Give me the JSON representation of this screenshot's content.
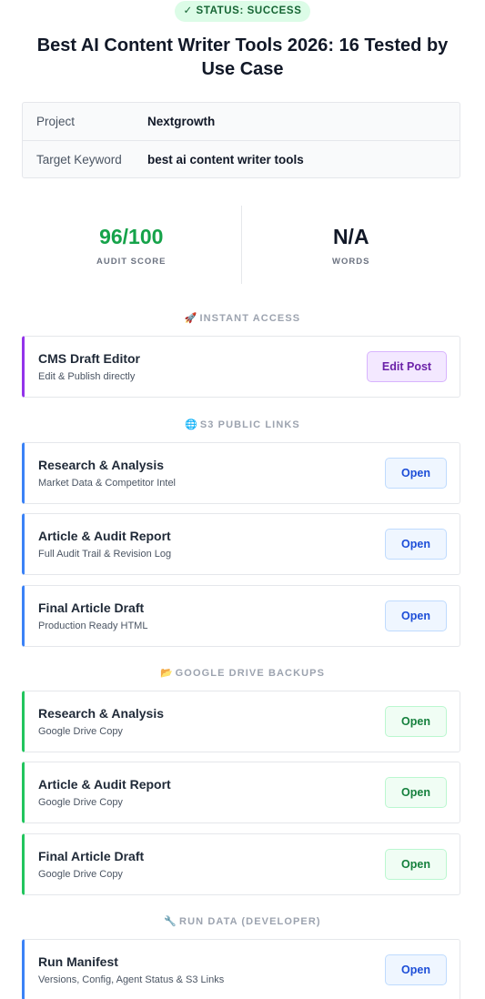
{
  "status": {
    "label": "✓ STATUS: SUCCESS"
  },
  "title": "Best AI Content Writer Tools 2026: 16 Tested by Use Case",
  "meta": [
    {
      "label": "Project",
      "value": "Nextgrowth"
    },
    {
      "label": "Target Keyword",
      "value": "best ai content writer tools"
    }
  ],
  "stats": [
    {
      "value": "96/100",
      "label": "AUDIT SCORE"
    },
    {
      "value": "N/A",
      "label": "WORDS"
    }
  ],
  "sections": {
    "instant": {
      "icon": "🚀",
      "title": "INSTANT ACCESS"
    },
    "s3": {
      "icon": "🌐",
      "title": "S3 PUBLIC LINKS"
    },
    "drive": {
      "icon": "📂",
      "title": "GOOGLE DRIVE BACKUPS"
    },
    "run": {
      "icon": "🔧",
      "title": "RUN DATA (DEVELOPER)"
    }
  },
  "cms_card": {
    "title": "CMS Draft Editor",
    "subtitle": "Edit & Publish directly",
    "button": "Edit Post"
  },
  "s3_cards": [
    {
      "title": "Research & Analysis",
      "subtitle": "Market Data & Competitor Intel",
      "button": "Open"
    },
    {
      "title": "Article & Audit Report",
      "subtitle": "Full Audit Trail & Revision Log",
      "button": "Open"
    },
    {
      "title": "Final Article Draft",
      "subtitle": "Production Ready HTML",
      "button": "Open"
    }
  ],
  "drive_cards": [
    {
      "title": "Research & Analysis",
      "subtitle": "Google Drive Copy",
      "button": "Open"
    },
    {
      "title": "Article & Audit Report",
      "subtitle": "Google Drive Copy",
      "button": "Open"
    },
    {
      "title": "Final Article Draft",
      "subtitle": "Google Drive Copy",
      "button": "Open"
    }
  ],
  "run_card": {
    "title": "Run Manifest",
    "subtitle": "Versions, Config, Agent Status & S3 Links",
    "button": "Open"
  },
  "colors": {
    "success": "#16a34a",
    "accent_purple": "#9333ea",
    "accent_blue": "#3b82f6",
    "accent_green": "#22c55e"
  }
}
